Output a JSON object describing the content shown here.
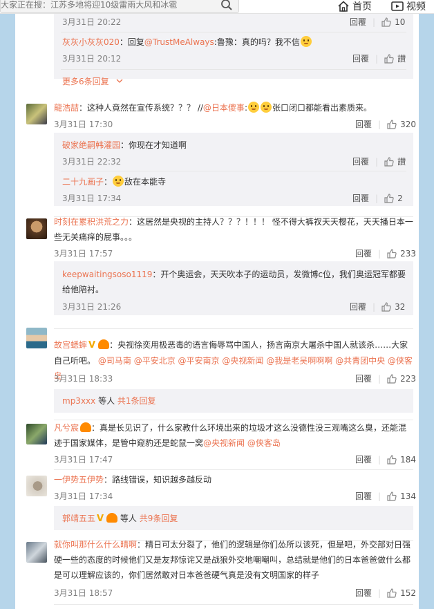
{
  "topbar": {
    "search_placeholder": "大家正在搜：江苏多地将迎10级雷雨大风和冰雹",
    "nav_home": "首页",
    "nav_video": "视频"
  },
  "colors": {
    "accent": "#eb7350",
    "page_bg": "#b6d5ea",
    "reply_bg": "#f2f2f5"
  },
  "labels": {
    "reply": "回覆",
    "like": "讃"
  },
  "sub0": {
    "time": "3月31日 20:22",
    "likes": "10"
  },
  "sub1": {
    "user": "灰灰小灰灰020",
    "colon": "：回复",
    "mention": "@TrustMeAlways",
    "text": ":鲁豫：真的吗？我不信",
    "time": "3月31日 20:12"
  },
  "more1": "更多6条回复",
  "c1": {
    "user": "龍浩喆",
    "text": "：这种人竟然在宣传系统？？？ //",
    "mention": "@日本傻事",
    "text2": ":",
    "text3": "张口闭口都能看出素质来。",
    "time": "3月31日 17:30",
    "likes": "320"
  },
  "c1r1": {
    "user": "破家绝嗣韩灌园",
    "text": "：你现在才知道啊",
    "time": "3月31日 22:32"
  },
  "c1r2": {
    "user": "二十九画子",
    "text": "：",
    "text2": "敌在本能寺",
    "time": "3月31日 17:34",
    "likes": "2"
  },
  "c2": {
    "user": "时刻在累积洪荒之力",
    "text": "：这居然是央视的主持人？？？！！！ 怪不得大裤衩天天樱花，天天播日本一些无关痛痒的屁事。。。",
    "time": "3月31日 17:57",
    "likes": "233"
  },
  "c2r1": {
    "user": "keepwaitingsoso1119",
    "text": "：开个奥运会，天天吹本子的运动员，发微博c位，我们奥运冠军都要给他陪衬。",
    "time": "3月31日 21:26",
    "likes": "32"
  },
  "c3": {
    "user": "故宫蟋蟀",
    "text": "：央视徐奕用极恶毒的语言侮辱骂中国人，扬言南京大屠杀中国人就该杀……大家自己听吧。",
    "mentions": [
      "@司马南",
      "@平安北京",
      "@平安南京",
      "@央视新闻",
      "@我是老吴啊啊啊",
      "@共青团中央",
      "@侠客岛"
    ],
    "time": "3月31日 18:33",
    "likes": "223"
  },
  "c3more": {
    "user": "mp3xxx",
    "mid": " 等人 ",
    "link": "共1条回复"
  },
  "c4": {
    "user": "凡兮宸",
    "text": "：真是长见识了，什么家教什么环境出来的垃圾才这么没德性没三观嘴这么臭，还能混迹于国家媒体，是管中窥豹还是蛇鼠一窝",
    "mentions": [
      "@央视新闻",
      "@侠客岛"
    ],
    "time": "3月31日 17:47",
    "likes": "184"
  },
  "c5": {
    "user": "一伊势五伊势",
    "text": "：路线错误，知识越多越反动",
    "time": "3月31日 17:34",
    "likes": "134"
  },
  "c5more": {
    "user": "郭靖五五",
    "mid": " 等人 ",
    "link": "共9条回复"
  },
  "c6": {
    "user": "就你叫那什么什么晴啊",
    "text": "：精日可太分裂了，他们的逻辑是你们怂所以该死，但是吧，外交部对日强硬一些的态度的时候他们又是友邦惊诧又是战狼外交地嘲嘲叫，总结就是他们的日本爸爸做什么都是可以理解应该的，你们居然敢对日本爸爸硬气真是没有文明国家的样子",
    "time": "3月31日 18:57",
    "likes": "152"
  }
}
